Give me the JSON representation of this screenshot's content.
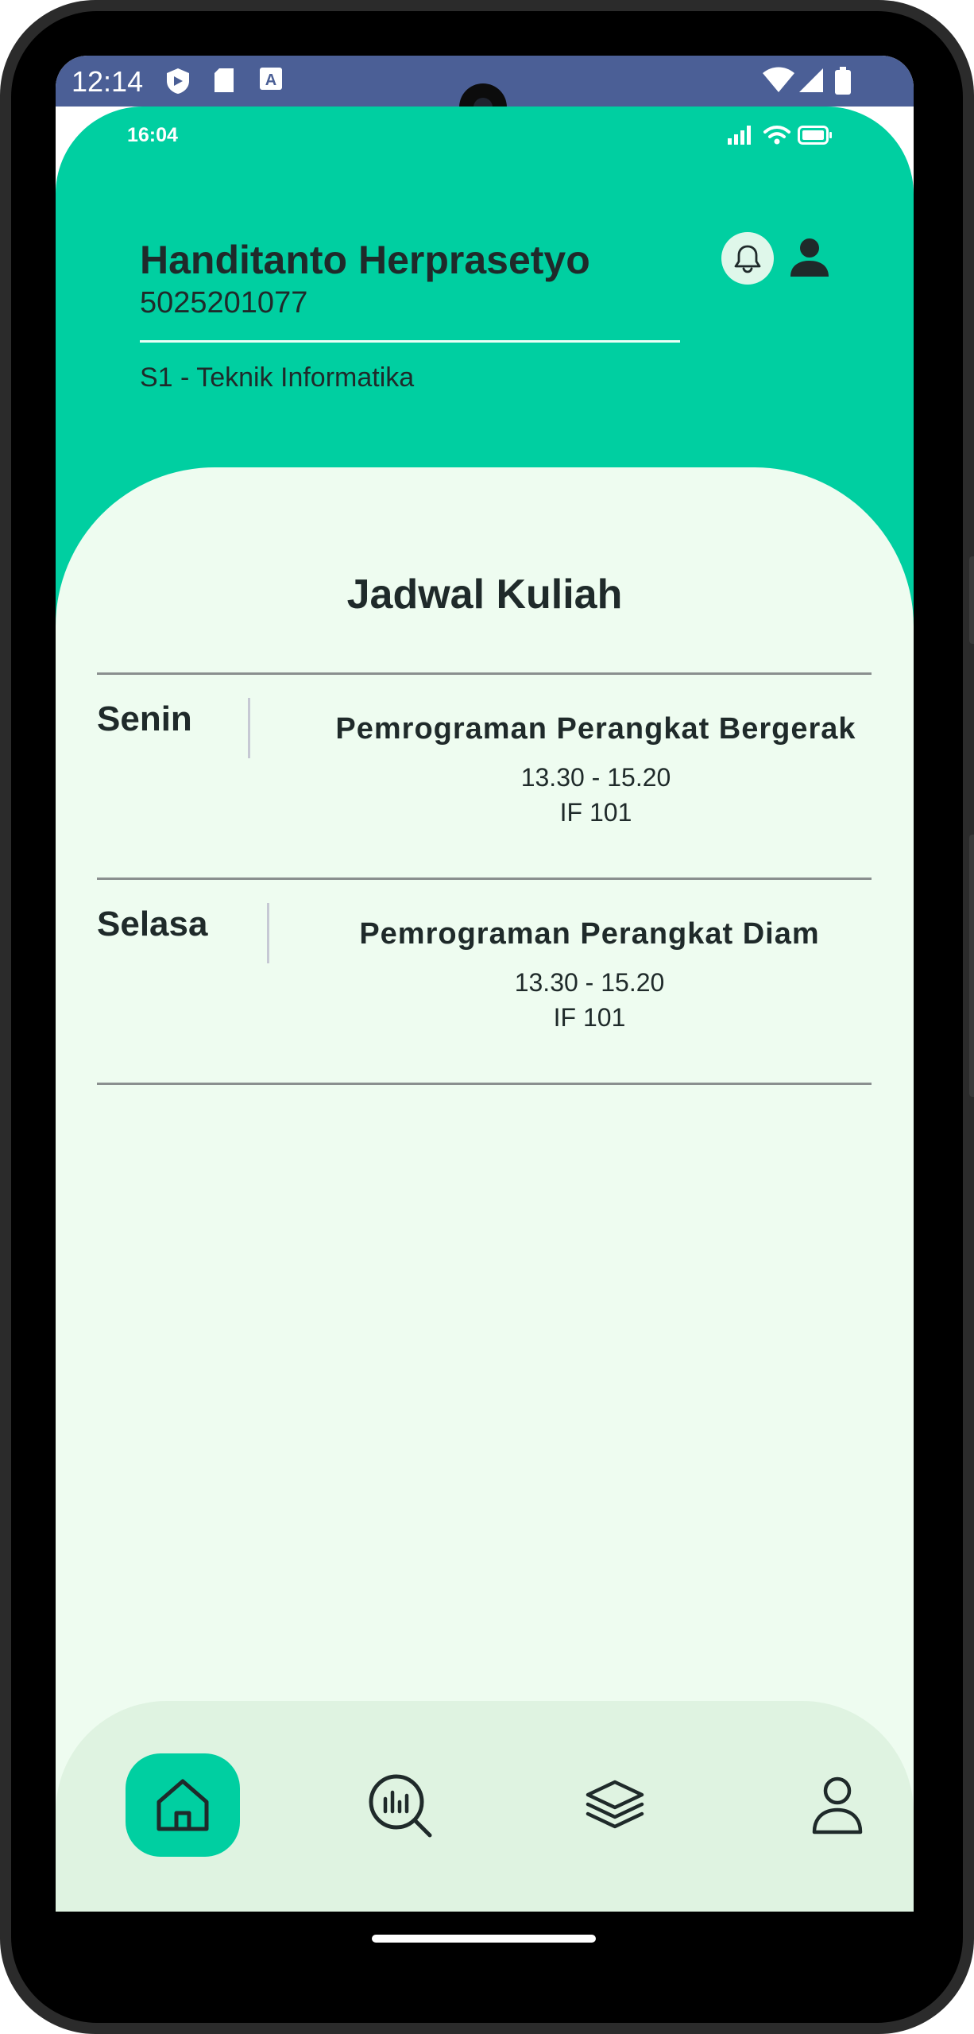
{
  "system_status": {
    "time": "12:14",
    "left_icons": [
      "shield-icon",
      "sd-card-icon",
      "keyboard-a-icon"
    ],
    "right_icons": [
      "wifi-icon",
      "cellular-icon",
      "battery-icon"
    ]
  },
  "app_status": {
    "time": "16:04"
  },
  "profile": {
    "name": "Handitanto Herprasetyo",
    "student_id": "5025201077",
    "program": "S1 - Teknik Informatika"
  },
  "schedule": {
    "title": "Jadwal Kuliah",
    "items": [
      {
        "day": "Senin",
        "course": "Pemrograman Perangkat Bergerak",
        "time": "13.30 - 15.20",
        "room": "IF 101"
      },
      {
        "day": "Selasa",
        "course": "Pemrograman Perangkat Diam",
        "time": "13.30 - 15.20",
        "room": "IF 101"
      }
    ]
  },
  "nav": {
    "items": [
      "home-icon",
      "analytics-search-icon",
      "layers-icon",
      "profile-icon"
    ],
    "active": "home-icon"
  },
  "colors": {
    "accent": "#00cfa1",
    "content_bg": "#eefcf0",
    "nav_bg": "#dff3e1",
    "status_bar": "#4b5f96"
  }
}
